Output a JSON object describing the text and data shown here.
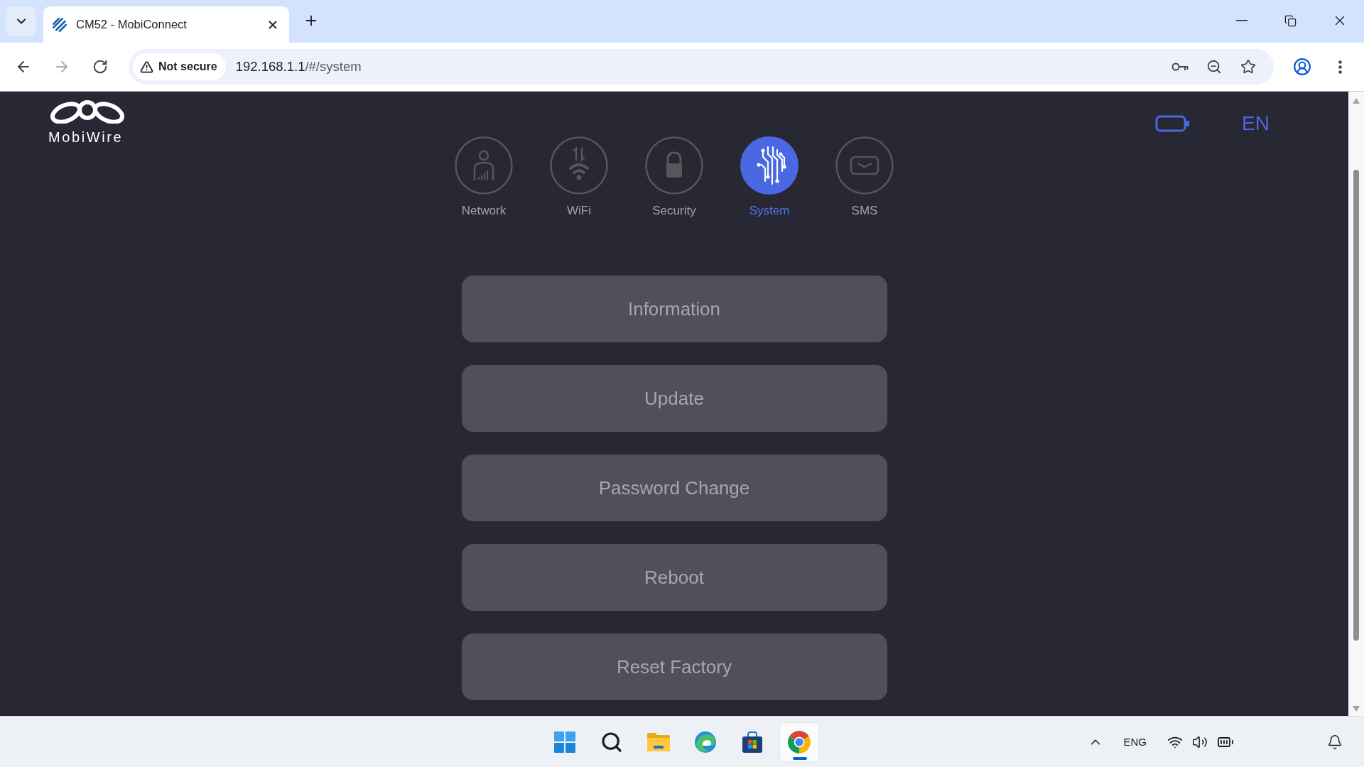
{
  "browser": {
    "tabs": [
      {
        "title": "CM52 - MobiConnect",
        "selected": true
      }
    ],
    "nav_buttons": [
      {
        "kind": "back",
        "disabled": false
      },
      {
        "kind": "forward",
        "disabled": true
      },
      {
        "kind": "reload",
        "disabled": false
      }
    ],
    "address_bar": {
      "security_label": "Not secure",
      "url_host": "192.168.1.1",
      "url_path": "/#/system"
    }
  },
  "page": {
    "logo_text": "MobiWire",
    "language": "EN",
    "nav": [
      {
        "kind": "network",
        "label": "Network",
        "selected": false
      },
      {
        "kind": "wifi",
        "label": "WiFi",
        "selected": false
      },
      {
        "kind": "security",
        "label": "Security",
        "selected": false
      },
      {
        "kind": "system",
        "label": "System",
        "selected": true
      },
      {
        "kind": "sms",
        "label": "SMS",
        "selected": false
      }
    ],
    "menu_buttons": [
      "Information",
      "Update",
      "Password Change",
      "Reboot",
      "Reset Factory"
    ]
  },
  "taskbar": {
    "apps": [
      {
        "kind": "start",
        "selected": false
      },
      {
        "kind": "search",
        "selected": false
      },
      {
        "kind": "folder",
        "selected": false
      },
      {
        "kind": "swirl",
        "selected": false
      },
      {
        "kind": "store",
        "selected": false
      },
      {
        "kind": "browser",
        "selected": true
      }
    ],
    "language": "ENG"
  }
}
